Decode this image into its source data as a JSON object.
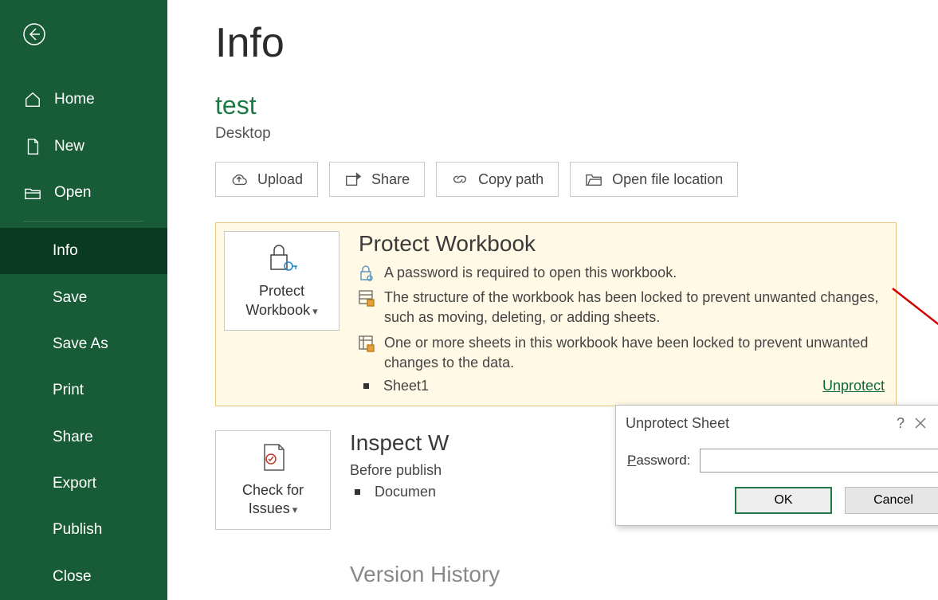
{
  "sidebar": {
    "items": [
      {
        "label": "Home"
      },
      {
        "label": "New"
      },
      {
        "label": "Open"
      },
      {
        "label": "Info"
      },
      {
        "label": "Save"
      },
      {
        "label": "Save As"
      },
      {
        "label": "Print"
      },
      {
        "label": "Share"
      },
      {
        "label": "Export"
      },
      {
        "label": "Publish"
      },
      {
        "label": "Close"
      }
    ]
  },
  "page": {
    "title": "Info",
    "doc_name": "test",
    "doc_location": "Desktop"
  },
  "actions": {
    "upload": "Upload",
    "share": "Share",
    "copy_path": "Copy path",
    "open_location": "Open file location"
  },
  "protect": {
    "button_line1": "Protect",
    "button_line2": "Workbook",
    "section_title": "Protect Workbook",
    "line_password": "A password is required to open this workbook.",
    "line_structure": "The structure of the workbook has been locked to prevent unwanted changes, such as moving, deleting, or adding sheets.",
    "line_sheets": "One or more sheets in this workbook have been locked to prevent unwanted changes to the data.",
    "sheet_name": "Sheet1",
    "unprotect_label": "Unprotect"
  },
  "inspect": {
    "button_line1": "Check for",
    "button_line2": "Issues",
    "section_title": "Inspect W",
    "before_text": "Before publish",
    "bullet1": "Documen"
  },
  "version": {
    "section_title": "Version History"
  },
  "dialog": {
    "title": "Unprotect Sheet",
    "password_label_u": "P",
    "password_label_rest": "assword:",
    "ok": "OK",
    "cancel": "Cancel"
  }
}
